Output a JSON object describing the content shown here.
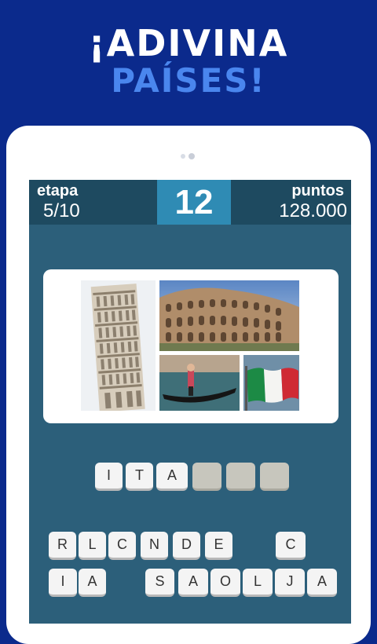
{
  "header": {
    "line1": "¡ADIVINA",
    "line2": "PAÍSES!"
  },
  "stats": {
    "stage_label": "etapa",
    "stage_value": "5/10",
    "level": "12",
    "points_label": "puntos",
    "points_value": "128.000"
  },
  "photos": [
    "leaning-tower-pisa",
    "colosseum",
    "venice-gondola",
    "italian-flag"
  ],
  "answer_slots": [
    "I",
    "T",
    "A",
    "",
    "",
    ""
  ],
  "letter_row1": [
    "R",
    "L",
    "C",
    "N",
    "D",
    "E",
    "",
    "C"
  ],
  "letter_row2": [
    "I",
    "A",
    "",
    "S",
    "A",
    "O",
    "L",
    "J",
    "A"
  ],
  "colors": {
    "background": "#0b2a8c",
    "accent": "#4a86ee",
    "panel": "#2c5f7a",
    "level_box": "#2f8bb4"
  }
}
